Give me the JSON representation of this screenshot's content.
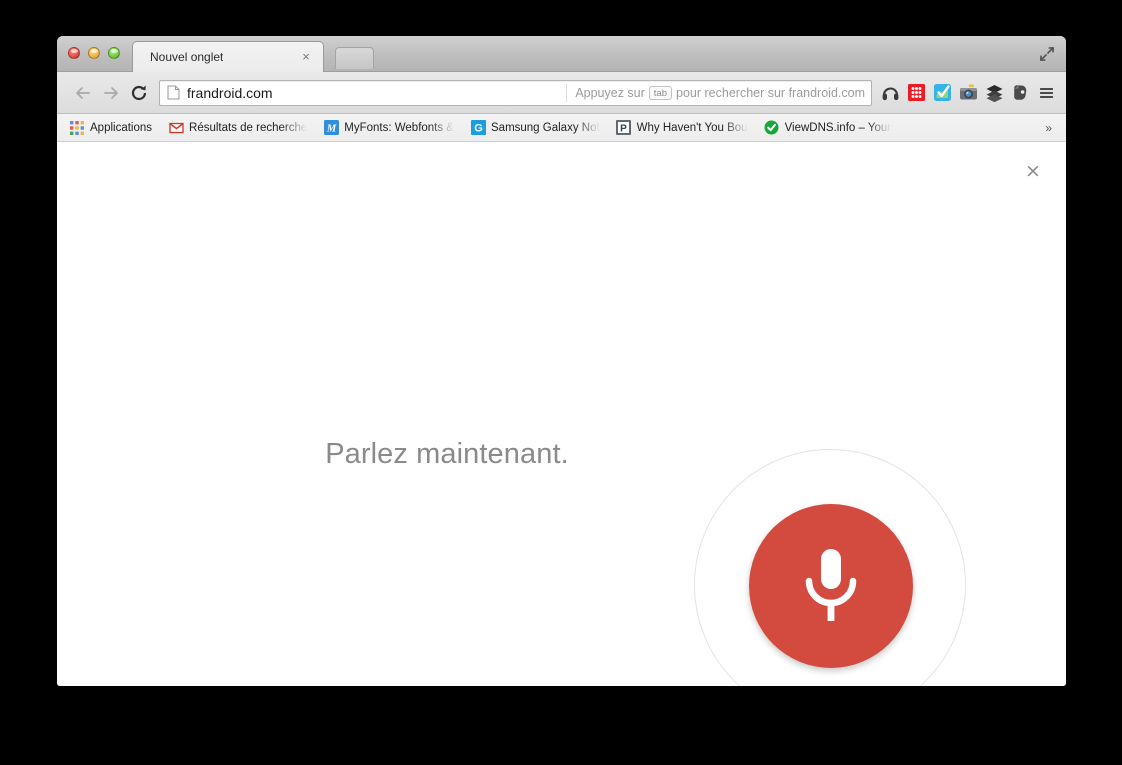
{
  "window": {
    "traffic_lights": [
      "close",
      "minimize",
      "zoom"
    ],
    "fullscreen_icon": "fullscreen-arrows-icon"
  },
  "tab_strip": {
    "active_tab_title": "Nouvel onglet",
    "tab_close_glyph": "×",
    "new_tab_label": "+"
  },
  "toolbar": {
    "back_icon": "arrow-left-icon",
    "forward_icon": "arrow-right-icon",
    "reload_icon": "reload-icon",
    "page_icon": "document-icon",
    "url": "frandroid.com",
    "hint_prefix": "Appuyez sur",
    "hint_key": "tab",
    "hint_suffix": "pour rechercher sur frandroid.com",
    "menu_icon": "hamburger-menu-icon",
    "extensions": [
      {
        "name": "headphones-icon",
        "title": "Headphones"
      },
      {
        "name": "red-grid-icon",
        "title": "Red grid"
      },
      {
        "name": "blue-check-icon",
        "title": "Blue check"
      },
      {
        "name": "camera-icon",
        "title": "Camera"
      },
      {
        "name": "layers-icon",
        "title": "Buffer layers"
      },
      {
        "name": "evernote-icon",
        "title": "Evernote"
      }
    ]
  },
  "bookmarks": {
    "items": [
      {
        "label": "Applications",
        "favicon": "apps-grid-icon"
      },
      {
        "label": "Résultats de recherche",
        "favicon": "gmail-icon"
      },
      {
        "label": "MyFonts: Webfonts &",
        "favicon": "myfonts-icon"
      },
      {
        "label": "Samsung Galaxy Not",
        "favicon": "clipboard-g-icon"
      },
      {
        "label": "Why Haven't You Bou",
        "favicon": "pocket-p-icon"
      },
      {
        "label": "ViewDNS.info – Your",
        "favicon": "green-check-icon"
      }
    ],
    "overflow_glyph": "»"
  },
  "page": {
    "close_glyph": "×",
    "prompt": "Parlez maintenant.",
    "mic_icon": "microphone-icon",
    "mic_color": "#d34a3e",
    "prompt_color": "#8a8a8a",
    "ring_color": "#e3e3e3"
  }
}
